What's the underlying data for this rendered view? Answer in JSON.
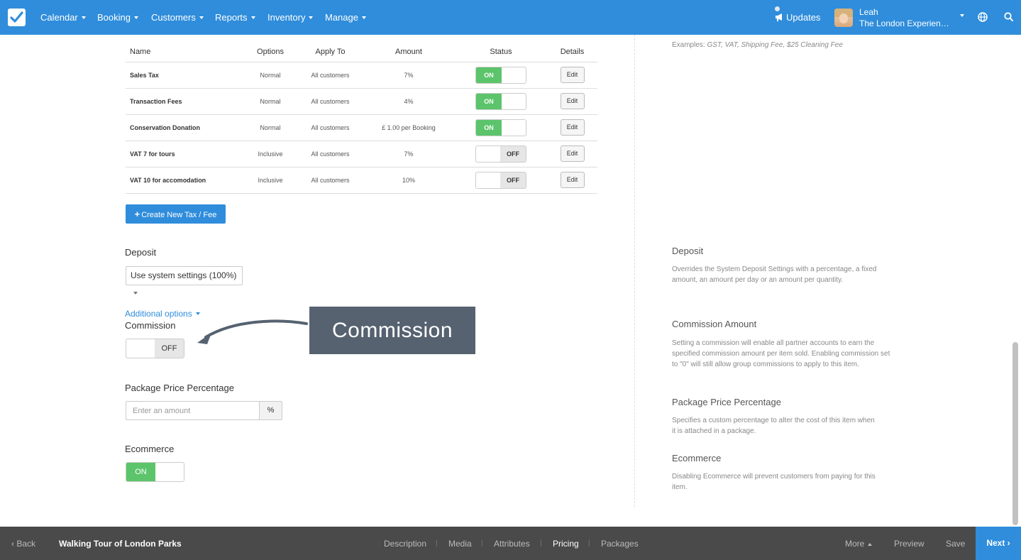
{
  "nav": {
    "items": [
      "Calendar",
      "Booking",
      "Customers",
      "Reports",
      "Inventory",
      "Manage"
    ],
    "updates_label": "Updates",
    "user_name": "Leah",
    "user_org": "The London Experienc..."
  },
  "taxes": {
    "headers": {
      "name": "Name",
      "options": "Options",
      "apply_to": "Apply To",
      "amount": "Amount",
      "status": "Status",
      "details": "Details"
    },
    "rows": [
      {
        "name": "Sales Tax",
        "options": "Normal",
        "apply_to": "All customers",
        "amount": "7%",
        "status": "ON",
        "action": "Edit"
      },
      {
        "name": "Transaction Fees",
        "options": "Normal",
        "apply_to": "All customers",
        "amount": "4%",
        "status": "ON",
        "action": "Edit"
      },
      {
        "name": "Conservation Donation",
        "options": "Normal",
        "apply_to": "All customers",
        "amount": "£ 1.00 per Booking",
        "status": "ON",
        "action": "Edit"
      },
      {
        "name": "VAT 7 for tours",
        "options": "Inclusive",
        "apply_to": "All customers",
        "amount": "7%",
        "status": "OFF",
        "action": "Edit"
      },
      {
        "name": "VAT 10 for accomodation",
        "options": "Inclusive",
        "apply_to": "All customers",
        "amount": "10%",
        "status": "OFF",
        "action": "Edit"
      }
    ],
    "create_label": "Create New Tax / Fee"
  },
  "deposit": {
    "label": "Deposit",
    "selected": "Use system settings (100%)"
  },
  "additional_options_label": "Additional options",
  "commission": {
    "label": "Commission",
    "state": "OFF"
  },
  "package_price": {
    "label": "Package Price Percentage",
    "placeholder": "Enter an amount",
    "addon": "%"
  },
  "ecommerce": {
    "label": "Ecommerce",
    "state": "ON"
  },
  "callout_label": "Commission",
  "help": {
    "examples_prefix": "Examples: ",
    "examples": "GST, VAT, Shipping Fee, $25 Cleaning Fee",
    "deposit_title": "Deposit",
    "deposit_text": "Overrides the System Deposit Settings with a percentage, a fixed amount, an amount per day or an amount per quantity.",
    "commission_title": "Commission Amount",
    "commission_text": "Setting a commission will enable all partner accounts to earn the specified commission amount per item sold. Enabling commission set to \"0\" will still allow group commissions to apply to this item.",
    "package_title": "Package Price Percentage",
    "package_text": "Specifies a custom percentage to alter the cost of this item when it is attached in a package.",
    "ecommerce_title": "Ecommerce",
    "ecommerce_text": "Disabling Ecommerce will prevent customers from paying for this item."
  },
  "bottom": {
    "back": "Back",
    "title": "Walking Tour of London Parks",
    "tabs": [
      "Description",
      "Media",
      "Attributes",
      "Pricing",
      "Packages"
    ],
    "active_tab": "Pricing",
    "more": "More",
    "preview": "Preview",
    "save": "Save",
    "next": "Next"
  },
  "colors": {
    "primary": "#2f8ddb",
    "on_green": "#5cc46b",
    "bottom_bar": "#4a4a4a",
    "callout": "#566270"
  }
}
